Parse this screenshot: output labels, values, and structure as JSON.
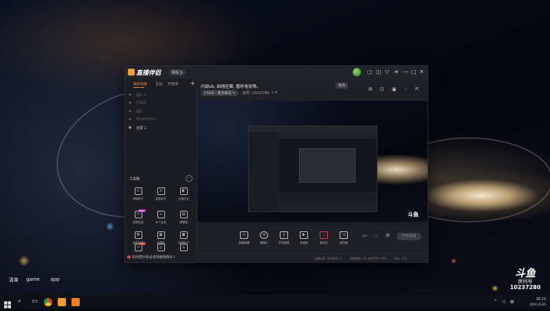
{
  "desktop": {
    "icons": [
      {
        "label": "清单"
      },
      {
        "label": "game"
      },
      {
        "label": "app"
      }
    ]
  },
  "app": {
    "logo_text": "直播伴侣",
    "version_badge": "新版 ❯",
    "tabs": [
      {
        "label": "我的场景"
      },
      {
        "label": "互动"
      },
      {
        "label": "开放场"
      }
    ],
    "scenes": [
      {
        "label": "图片 1"
      },
      {
        "label": "CSGO"
      },
      {
        "label": "图片"
      },
      {
        "label": "Scroll&Fill 1"
      },
      {
        "label": "全屏 1"
      }
    ],
    "tools_heading": "工具箱",
    "tools": [
      {
        "label": "弹幕助手"
      },
      {
        "label": "录屏助手"
      },
      {
        "label": "主播任务"
      },
      {
        "label": "视频连麦",
        "badge": "NEW"
      },
      {
        "label": "本人连麦"
      },
      {
        "label": "弹幕姬"
      },
      {
        "label": "福利抽奖"
      },
      {
        "label": "弹幕板"
      },
      {
        "label": "直播助手"
      },
      {
        "label": "更多工具",
        "badge": "HOT"
      },
      {
        "label": "主播活动"
      },
      {
        "label": "主播日志"
      }
    ],
    "bottom_tip": "如何把手机设成电脑摄像头?",
    "room": {
      "title": "内部ob, 四地区赛, 看听电竞等。",
      "edit_label": "修改",
      "category": "CSGO - 数字解说",
      "room_no_label": "房号: 10237280",
      "fans_label": "4"
    },
    "controls": [
      {
        "label": "直播屏幕",
        "icon": "screen-icon"
      },
      {
        "label": "摄像头",
        "icon": "camera-icon"
      },
      {
        "label": "手机投屏",
        "icon": "phone-icon"
      },
      {
        "label": "多媒体",
        "icon": "play-icon"
      },
      {
        "label": "麦克风",
        "icon": "mic-icon"
      },
      {
        "label": "扬声器",
        "icon": "speaker-icon"
      }
    ],
    "go_live_label": "开始直播",
    "status": [
      {
        "text": "直播码率: 0kb/s"
      },
      {
        "text": "FPS: 0"
      },
      {
        "text": "直播网络: 0% 良好"
      },
      {
        "text": "CPU: 16%"
      },
      {
        "text": "内存: 45%"
      }
    ],
    "watermark": "斗鱼"
  },
  "taskbar": {
    "clock_time": "16:13",
    "clock_date": "2021-12-05"
  },
  "corner_watermark": {
    "logo": "斗鱼",
    "room_label": "房间号",
    "room_number": "10237280"
  }
}
